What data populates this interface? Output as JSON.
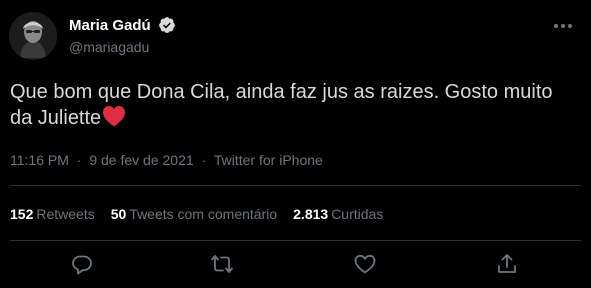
{
  "author": {
    "display_name": "Maria Gadú",
    "handle": "@mariagadu",
    "verified": true
  },
  "tweet": {
    "text": "Que bom que Dona Cila, ainda faz jus as raizes. Gosto muito da Juliette",
    "emoji": "red-heart"
  },
  "meta": {
    "time": "11:16 PM",
    "separator": "·",
    "date": "9 de fev de 2021",
    "source": "Twitter for iPhone"
  },
  "stats": {
    "retweets_count": "152",
    "retweets_label": "Retweets",
    "quotes_count": "50",
    "quotes_label": "Tweets com comentário",
    "likes_count": "2.813",
    "likes_label": "Curtidas"
  },
  "actions": [
    "reply-icon",
    "retweet-icon",
    "like-icon",
    "share-icon"
  ],
  "colors": {
    "background": "#000000",
    "text": "#d9d9d9",
    "muted": "#6e767d",
    "verified": "#d9d9d9",
    "heart": "#e0245e"
  }
}
